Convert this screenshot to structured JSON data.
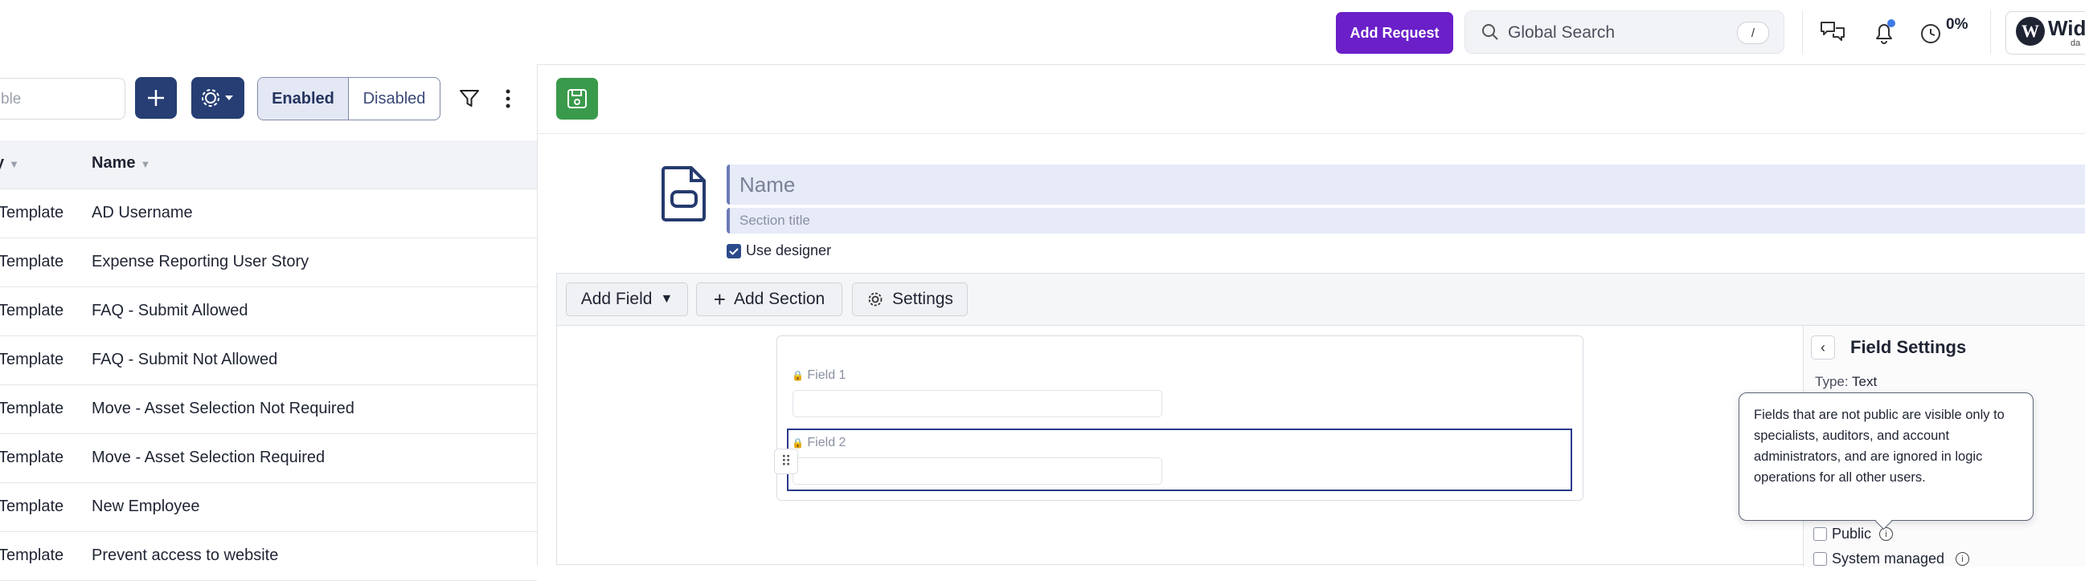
{
  "topbar": {
    "add_request": "Add Request",
    "search_label": "Global Search",
    "search_shortcut": "/",
    "progress_pct": "0%",
    "logo_text": "Wid",
    "logo_sub": "da"
  },
  "left": {
    "filter_placeholder": "ble",
    "toggle_enabled": "Enabled",
    "toggle_disabled": "Disabled",
    "columns": [
      "y",
      "Name"
    ],
    "rows": [
      {
        "type": "Template",
        "name": "AD Username"
      },
      {
        "type": "Template",
        "name": "Expense Reporting User Story"
      },
      {
        "type": "Template",
        "name": "FAQ - Submit Allowed"
      },
      {
        "type": "Template",
        "name": "FAQ - Submit Not Allowed"
      },
      {
        "type": "Template",
        "name": "Move - Asset Selection Not Required"
      },
      {
        "type": "Template",
        "name": "Move - Asset Selection Required"
      },
      {
        "type": "Template",
        "name": "New Employee"
      },
      {
        "type": "Template",
        "name": "Prevent access to website"
      }
    ]
  },
  "editor": {
    "name_placeholder": "Name",
    "section_placeholder": "Section title",
    "use_designer": "Use designer",
    "toolbar": {
      "add_field": "Add Field",
      "add_section": "Add Section",
      "settings": "Settings"
    },
    "fields": [
      "Field 1",
      "Field 2"
    ]
  },
  "field_settings": {
    "title": "Field Settings",
    "type_label": "Type:",
    "type_value": "Text",
    "public": "Public",
    "system_managed": "System managed",
    "tooltip": "Fields that are not public are visible only to specialists, auditors, and account administrators, and are ignored in logic operations for all other users."
  },
  "colors": {
    "accent_purple": "#6a1fc9",
    "navy": "#263e74",
    "save_green": "#3a9a4b",
    "selection": "#2b3a8c"
  }
}
